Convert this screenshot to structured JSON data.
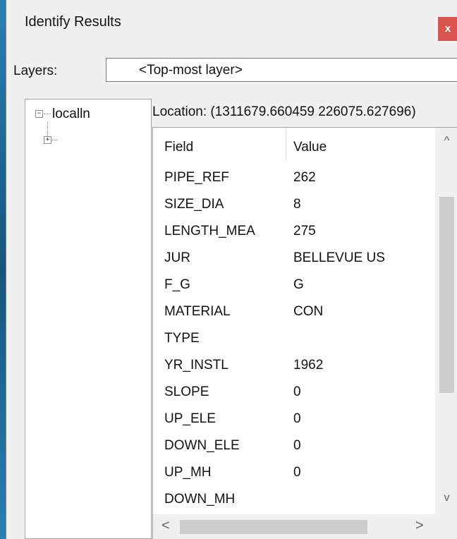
{
  "window": {
    "title": "Identify Results",
    "close_label": "x"
  },
  "layers": {
    "label": "Layers:",
    "selected": "<Top-most layer>"
  },
  "tree": {
    "root_label": "localln",
    "root_expander": "−",
    "child_expander": "+"
  },
  "location": "Location: (1311679.660459 226075.627696)",
  "grid": {
    "headers": {
      "field": "Field",
      "value": "Value"
    },
    "rows": [
      {
        "field": "PIPE_REF",
        "value": "262"
      },
      {
        "field": "SIZE_DIA",
        "value": "8"
      },
      {
        "field": "LENGTH_MEA",
        "value": "275"
      },
      {
        "field": "JUR",
        "value": "BELLEVUE US"
      },
      {
        "field": "F_G",
        "value": "G"
      },
      {
        "field": "MATERIAL",
        "value": "CON"
      },
      {
        "field": "TYPE",
        "value": ""
      },
      {
        "field": "YR_INSTL",
        "value": "1962"
      },
      {
        "field": "SLOPE",
        "value": "0"
      },
      {
        "field": "UP_ELE",
        "value": "0"
      },
      {
        "field": "DOWN_ELE",
        "value": "0"
      },
      {
        "field": "UP_MH",
        "value": "0"
      },
      {
        "field": "DOWN_MH",
        "value": ""
      }
    ]
  },
  "scroll": {
    "up": "^",
    "down": "v",
    "left": "<",
    "right": ">"
  },
  "colors": {
    "close": "#d9534f",
    "desktop": "#1f6f9f"
  }
}
